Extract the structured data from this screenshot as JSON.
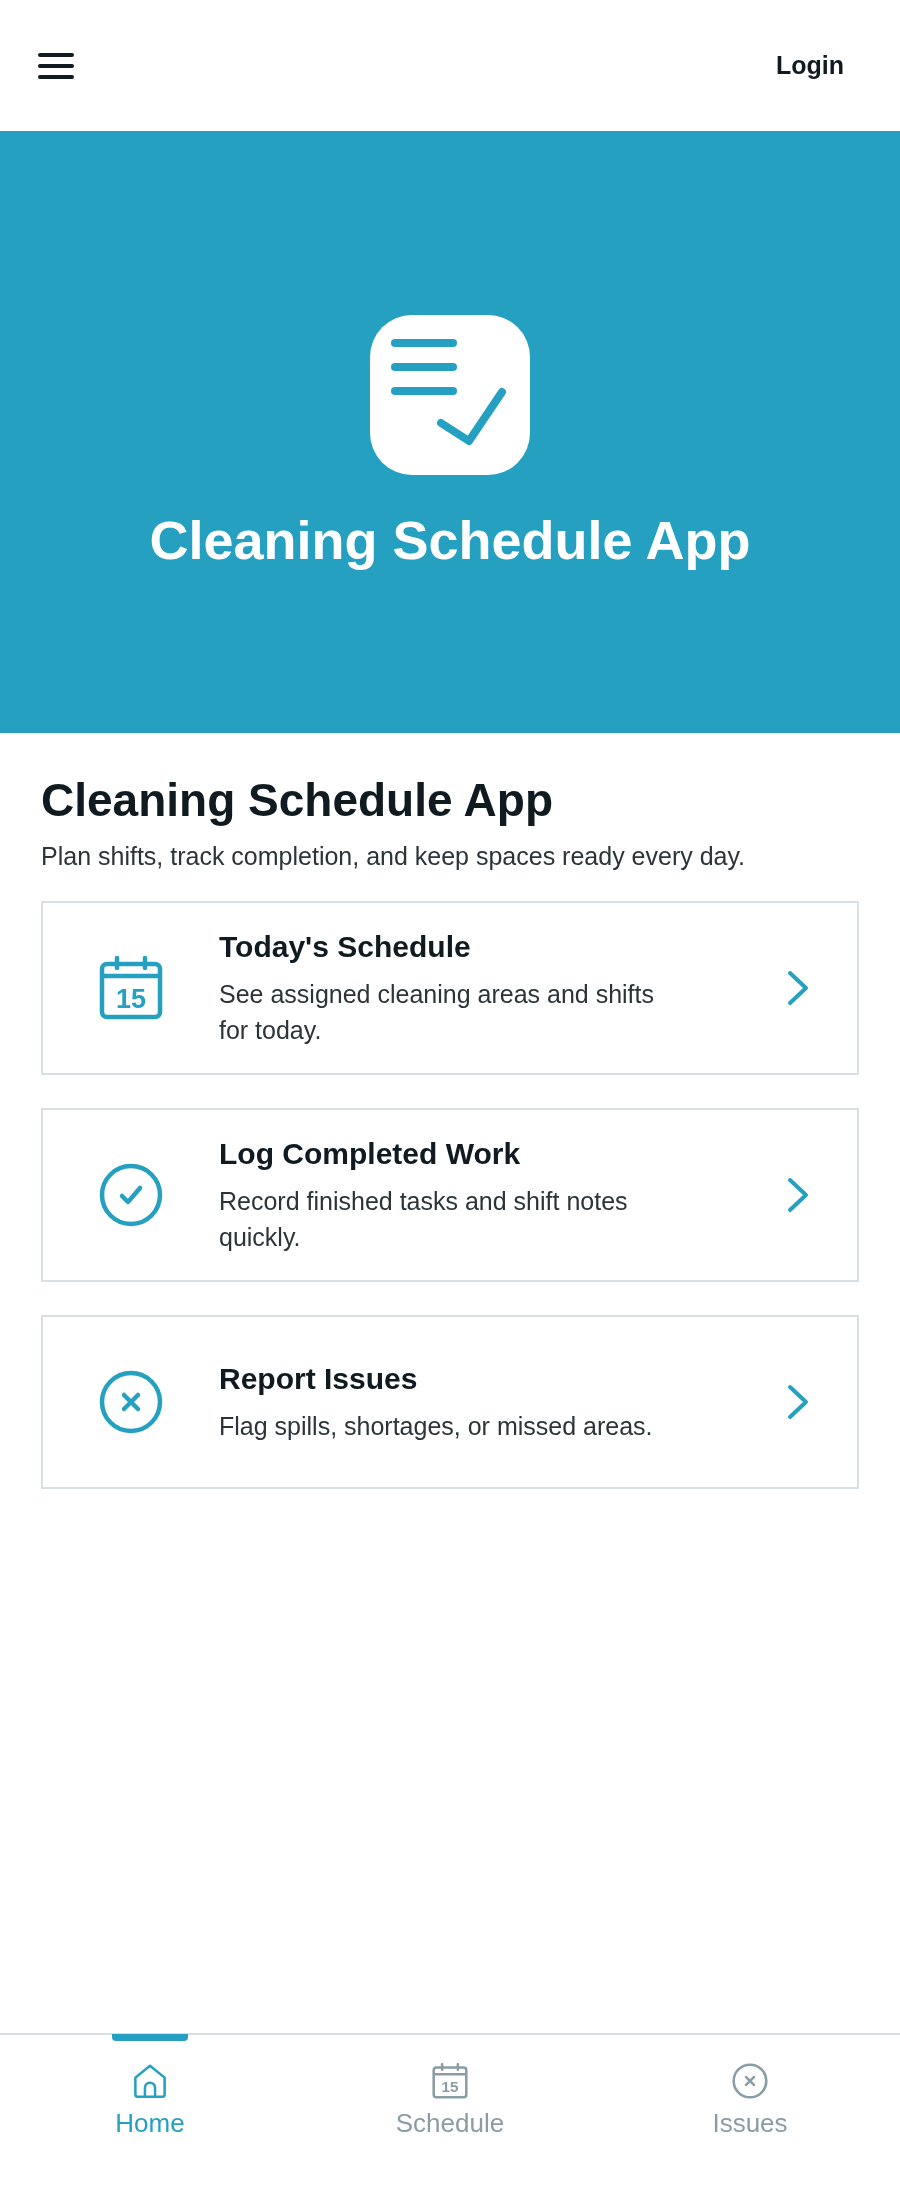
{
  "top_bar": {
    "login": "Login"
  },
  "hero": {
    "title": "Cleaning Schedule App"
  },
  "intro": {
    "title": "Cleaning Schedule App",
    "subtitle": "Plan shifts, track completion, and keep spaces ready every day."
  },
  "cards": [
    {
      "kind": "calendar",
      "icon_day": "15",
      "title": "Today's Schedule",
      "description": "See assigned cleaning areas and shifts for today."
    },
    {
      "kind": "check",
      "title": "Log Completed Work",
      "description": "Record finished tasks and shift notes quickly."
    },
    {
      "kind": "cross",
      "title": "Report Issues",
      "description": "Flag spills, shortages, or missed areas."
    }
  ],
  "bottom_nav": [
    {
      "kind": "home",
      "label": "Home",
      "selected": true
    },
    {
      "kind": "calendar",
      "icon_day": "15",
      "label": "Schedule",
      "selected": false
    },
    {
      "kind": "cross",
      "label": "Issues",
      "selected": false
    }
  ]
}
